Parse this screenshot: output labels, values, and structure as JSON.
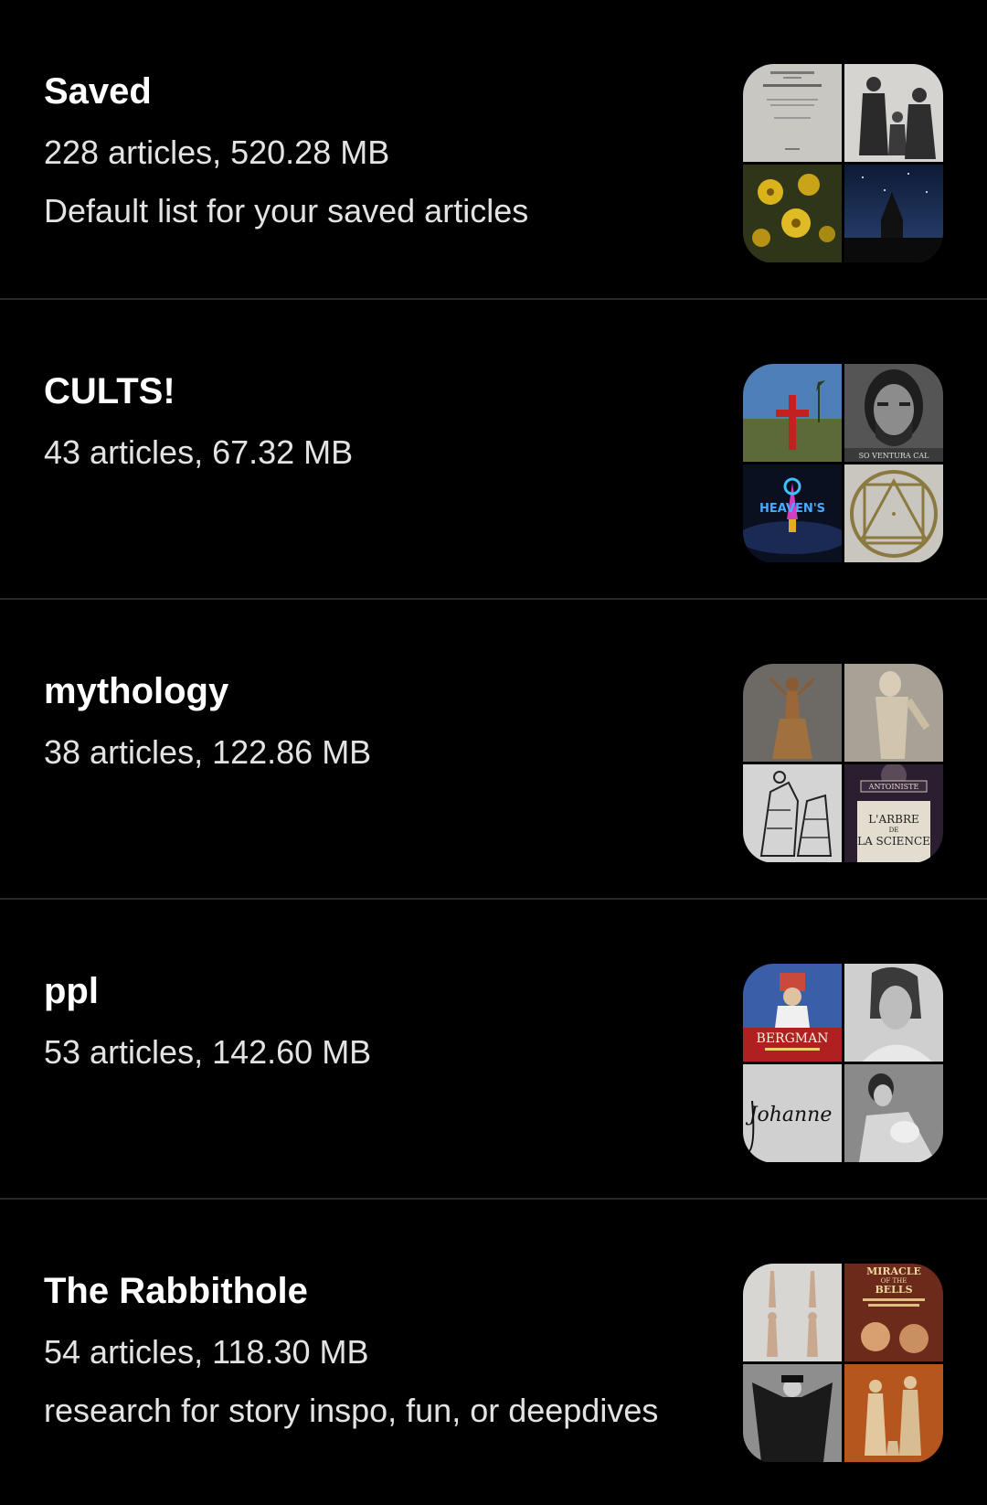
{
  "lists": [
    {
      "title": "Saved",
      "meta": "228 articles, 520.28 MB",
      "description": "Default list for your saved articles",
      "thumbnails": [
        "book-title-page",
        "victorian-portrait",
        "yellow-flowers",
        "church-night-sky"
      ]
    },
    {
      "title": "CULTS!",
      "meta": "43 articles, 67.32 MB",
      "description": "",
      "thumbnails": [
        "red-cross-field",
        "mugshot-portrait",
        "heavens-gate-logo",
        "occult-sigil"
      ],
      "thumb_texts": {
        "mugshot_caption": "SO VENTURA CAL",
        "heavens_gate": "HEAVEN'S"
      }
    },
    {
      "title": "mythology",
      "meta": "38 articles, 122.86 MB",
      "description": "",
      "thumbnails": [
        "snake-goddess-statue",
        "marble-statue",
        "engraving-figures",
        "antoinist-tree-poster"
      ],
      "thumb_texts": {
        "antoinist": "ANTOINISTE",
        "arbre_line1": "L'ARBRE",
        "arbre_line2": "DE",
        "arbre_line3": "LA SCIENCE"
      }
    },
    {
      "title": "ppl",
      "meta": "53 articles, 142.60 MB",
      "description": "",
      "thumbnails": [
        "bergman-poster",
        "woman-portrait",
        "signature",
        "mother-baby-photo"
      ],
      "thumb_texts": {
        "bergman": "BERGMAN",
        "signature": "Johanne"
      }
    },
    {
      "title": "The Rabbithole",
      "meta": "54 articles, 118.30 MB",
      "description": "research for story inspo, fun, or deepdives",
      "thumbnails": [
        "anatomy-figures",
        "miracle-bells-poster",
        "caped-figure",
        "statue-group"
      ],
      "thumb_texts": {
        "miracle": "MIRACLE",
        "of_the": "OF THE",
        "bells": "BELLS"
      }
    }
  ],
  "colors": {
    "background": "#000000",
    "divider": "#2a2a2a",
    "title": "#ffffff",
    "secondary": "#e3e3e3"
  }
}
